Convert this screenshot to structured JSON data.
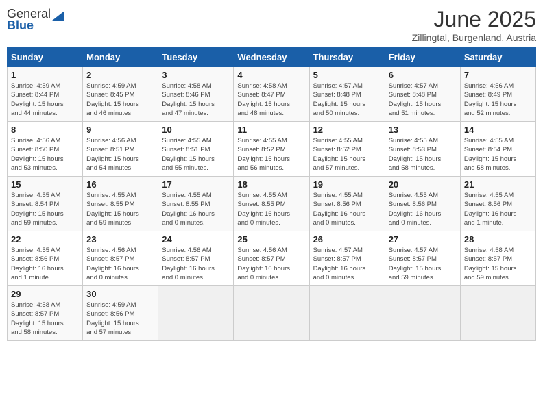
{
  "header": {
    "logo_general": "General",
    "logo_blue": "Blue",
    "month": "June 2025",
    "location": "Zillingtal, Burgenland, Austria"
  },
  "days_of_week": [
    "Sunday",
    "Monday",
    "Tuesday",
    "Wednesday",
    "Thursday",
    "Friday",
    "Saturday"
  ],
  "weeks": [
    [
      {
        "day": "1",
        "info": "Sunrise: 4:59 AM\nSunset: 8:44 PM\nDaylight: 15 hours\nand 44 minutes."
      },
      {
        "day": "2",
        "info": "Sunrise: 4:59 AM\nSunset: 8:45 PM\nDaylight: 15 hours\nand 46 minutes."
      },
      {
        "day": "3",
        "info": "Sunrise: 4:58 AM\nSunset: 8:46 PM\nDaylight: 15 hours\nand 47 minutes."
      },
      {
        "day": "4",
        "info": "Sunrise: 4:58 AM\nSunset: 8:47 PM\nDaylight: 15 hours\nand 48 minutes."
      },
      {
        "day": "5",
        "info": "Sunrise: 4:57 AM\nSunset: 8:48 PM\nDaylight: 15 hours\nand 50 minutes."
      },
      {
        "day": "6",
        "info": "Sunrise: 4:57 AM\nSunset: 8:48 PM\nDaylight: 15 hours\nand 51 minutes."
      },
      {
        "day": "7",
        "info": "Sunrise: 4:56 AM\nSunset: 8:49 PM\nDaylight: 15 hours\nand 52 minutes."
      }
    ],
    [
      {
        "day": "8",
        "info": "Sunrise: 4:56 AM\nSunset: 8:50 PM\nDaylight: 15 hours\nand 53 minutes."
      },
      {
        "day": "9",
        "info": "Sunrise: 4:56 AM\nSunset: 8:51 PM\nDaylight: 15 hours\nand 54 minutes."
      },
      {
        "day": "10",
        "info": "Sunrise: 4:55 AM\nSunset: 8:51 PM\nDaylight: 15 hours\nand 55 minutes."
      },
      {
        "day": "11",
        "info": "Sunrise: 4:55 AM\nSunset: 8:52 PM\nDaylight: 15 hours\nand 56 minutes."
      },
      {
        "day": "12",
        "info": "Sunrise: 4:55 AM\nSunset: 8:52 PM\nDaylight: 15 hours\nand 57 minutes."
      },
      {
        "day": "13",
        "info": "Sunrise: 4:55 AM\nSunset: 8:53 PM\nDaylight: 15 hours\nand 58 minutes."
      },
      {
        "day": "14",
        "info": "Sunrise: 4:55 AM\nSunset: 8:54 PM\nDaylight: 15 hours\nand 58 minutes."
      }
    ],
    [
      {
        "day": "15",
        "info": "Sunrise: 4:55 AM\nSunset: 8:54 PM\nDaylight: 15 hours\nand 59 minutes."
      },
      {
        "day": "16",
        "info": "Sunrise: 4:55 AM\nSunset: 8:55 PM\nDaylight: 15 hours\nand 59 minutes."
      },
      {
        "day": "17",
        "info": "Sunrise: 4:55 AM\nSunset: 8:55 PM\nDaylight: 16 hours\nand 0 minutes."
      },
      {
        "day": "18",
        "info": "Sunrise: 4:55 AM\nSunset: 8:55 PM\nDaylight: 16 hours\nand 0 minutes."
      },
      {
        "day": "19",
        "info": "Sunrise: 4:55 AM\nSunset: 8:56 PM\nDaylight: 16 hours\nand 0 minutes."
      },
      {
        "day": "20",
        "info": "Sunrise: 4:55 AM\nSunset: 8:56 PM\nDaylight: 16 hours\nand 0 minutes."
      },
      {
        "day": "21",
        "info": "Sunrise: 4:55 AM\nSunset: 8:56 PM\nDaylight: 16 hours\nand 1 minute."
      }
    ],
    [
      {
        "day": "22",
        "info": "Sunrise: 4:55 AM\nSunset: 8:56 PM\nDaylight: 16 hours\nand 1 minute."
      },
      {
        "day": "23",
        "info": "Sunrise: 4:56 AM\nSunset: 8:57 PM\nDaylight: 16 hours\nand 0 minutes."
      },
      {
        "day": "24",
        "info": "Sunrise: 4:56 AM\nSunset: 8:57 PM\nDaylight: 16 hours\nand 0 minutes."
      },
      {
        "day": "25",
        "info": "Sunrise: 4:56 AM\nSunset: 8:57 PM\nDaylight: 16 hours\nand 0 minutes."
      },
      {
        "day": "26",
        "info": "Sunrise: 4:57 AM\nSunset: 8:57 PM\nDaylight: 16 hours\nand 0 minutes."
      },
      {
        "day": "27",
        "info": "Sunrise: 4:57 AM\nSunset: 8:57 PM\nDaylight: 15 hours\nand 59 minutes."
      },
      {
        "day": "28",
        "info": "Sunrise: 4:58 AM\nSunset: 8:57 PM\nDaylight: 15 hours\nand 59 minutes."
      }
    ],
    [
      {
        "day": "29",
        "info": "Sunrise: 4:58 AM\nSunset: 8:57 PM\nDaylight: 15 hours\nand 58 minutes."
      },
      {
        "day": "30",
        "info": "Sunrise: 4:59 AM\nSunset: 8:56 PM\nDaylight: 15 hours\nand 57 minutes."
      },
      {
        "day": "",
        "info": ""
      },
      {
        "day": "",
        "info": ""
      },
      {
        "day": "",
        "info": ""
      },
      {
        "day": "",
        "info": ""
      },
      {
        "day": "",
        "info": ""
      }
    ]
  ]
}
